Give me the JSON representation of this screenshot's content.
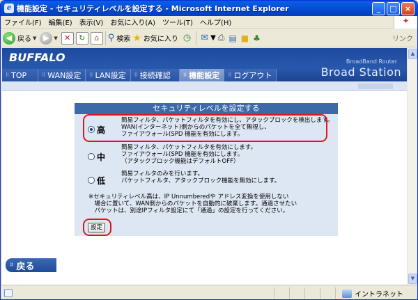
{
  "window": {
    "title": "機能設定 - セキュリティレベルを設定する - Microsoft Internet Explorer"
  },
  "menu": [
    "ファイル(F)",
    "編集(E)",
    "表示(V)",
    "お気に入り(A)",
    "ツール(T)",
    "ヘルプ(H)"
  ],
  "toolbar": {
    "back_label": "戻る",
    "search_label": "検索",
    "favorites_label": "お気に入り",
    "links_label": "リンク"
  },
  "header": {
    "logo": "BUFFALO",
    "product_small": "BroadBand Router",
    "product_large": "Broad Station"
  },
  "nav": [
    {
      "label": "TOP",
      "active": false
    },
    {
      "label": "WAN設定",
      "active": false
    },
    {
      "label": "LAN設定",
      "active": false
    },
    {
      "label": "接続確認",
      "active": false
    },
    {
      "label": "機能設定",
      "active": true
    },
    {
      "label": "ログアウト",
      "active": false
    }
  ],
  "panel": {
    "title": "セキュリティレベルを設定する",
    "options": [
      {
        "level": "高",
        "selected": true,
        "lines": [
          "簡易フィルタ、パケットフィルタを有効にし、アタックブロックを検出します。",
          "WAN(インターネット)側からのパケットを全て無視し、",
          "ファイアウォール(SPD 機能を有効にします。"
        ]
      },
      {
        "level": "中",
        "selected": false,
        "lines": [
          "簡易フィルタ、パケットフィルタを有効にします。",
          "ファイアウォール(SPD 機能を有効にします。",
          "（アタックブロック機能はデフォルトOFF）"
        ]
      },
      {
        "level": "低",
        "selected": false,
        "lines": [
          "簡易フィルタのみを行います。",
          "パケットフィルタ、アタックブロック機能を無効にします。"
        ]
      }
    ],
    "note_lines": [
      "※セキュリティレベル高は、IP Unnumberedや アドレス変換を使用しない",
      "　場合に置いて、WAN側からのパケットを自動的に破棄します。通過させたい",
      "　パケットは、別途IPフィルタ設定にて「通過」の設定を行ってください。"
    ],
    "submit_label": "設定"
  },
  "back_button_label": "戻る",
  "status": {
    "zone_label": "イントラネット"
  }
}
